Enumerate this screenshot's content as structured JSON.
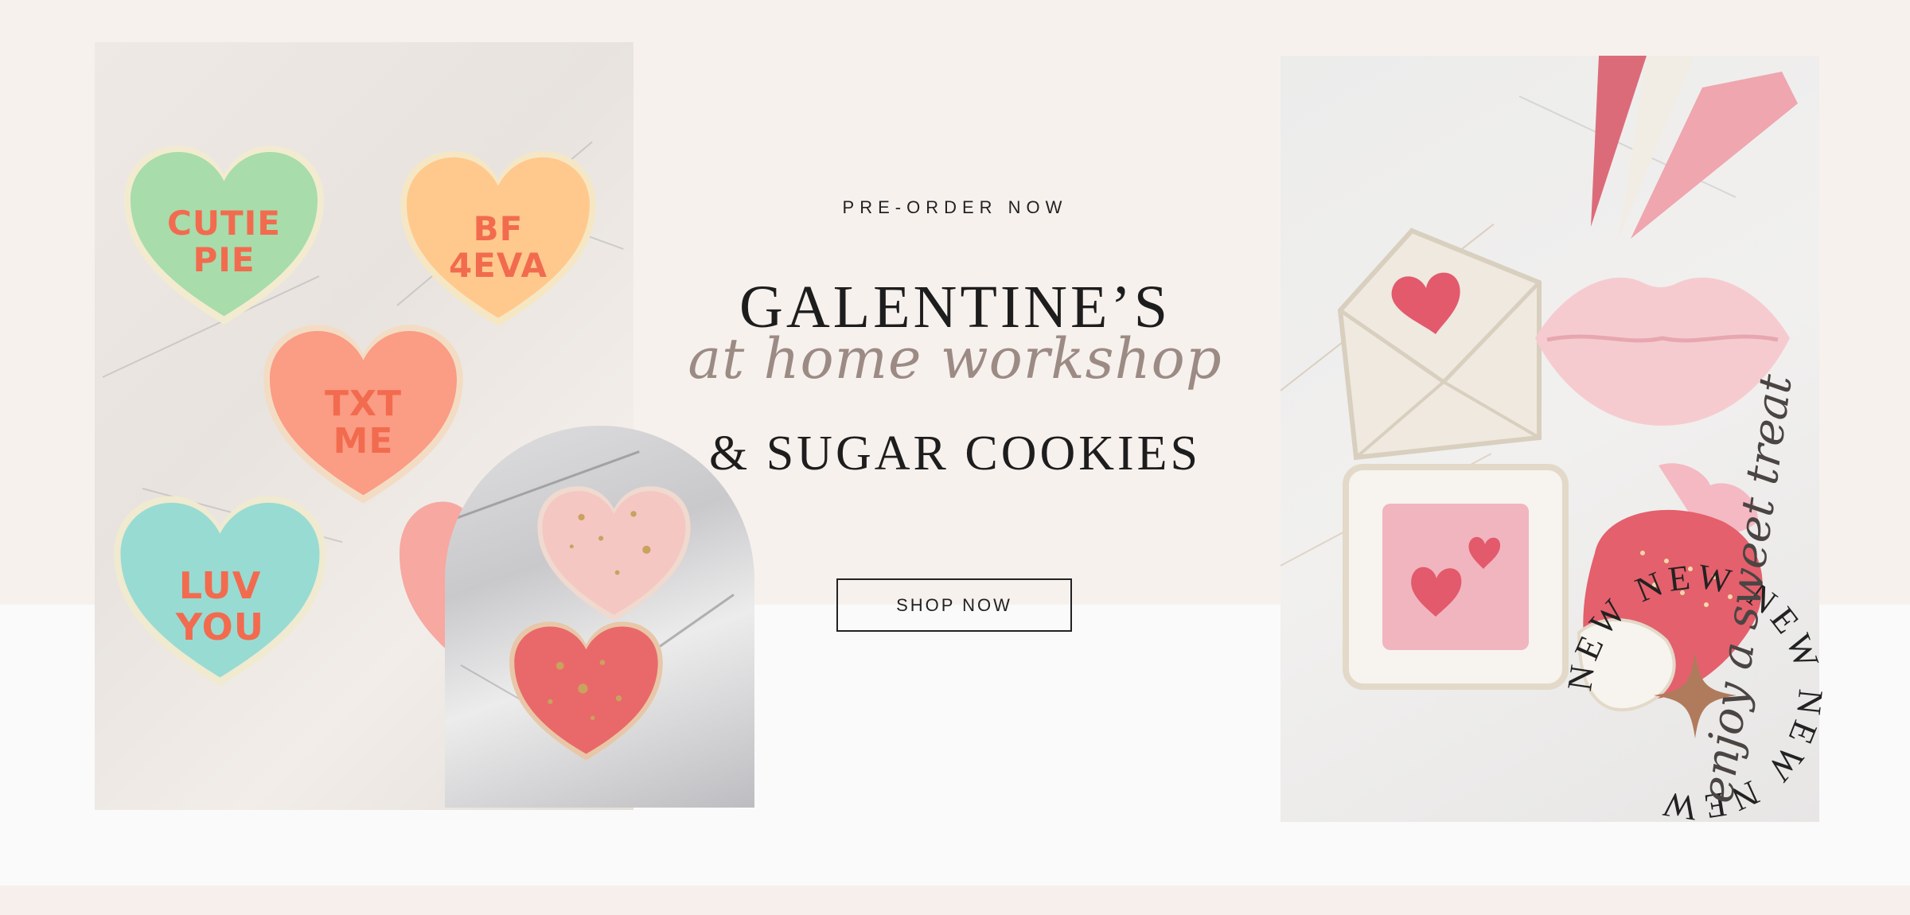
{
  "hero": {
    "eyebrow": "PRE-ORDER NOW",
    "title_line1": "GALENTINE’S",
    "title_script": "at home workshop",
    "title_line2": "& SUGAR COOKIES",
    "cta_label": "SHOP NOW"
  },
  "cookies_left": [
    {
      "label_line1": "CUTIE",
      "label_line2": "PIE",
      "color": "#a8dcab"
    },
    {
      "label_line1": "BF",
      "label_line2": "4EVA",
      "color": "#ffc98e"
    },
    {
      "label_line1": "TXT",
      "label_line2": "ME",
      "color": "#fb9c85"
    },
    {
      "label_line1": "LUV",
      "label_line2": "YOU",
      "color": "#98dbd3"
    }
  ],
  "badge": {
    "ring_text": "NEW NEW NEW NEW NEW",
    "script_text": "enjoy a sweet treat"
  },
  "colors": {
    "background": "#f7f1ee",
    "accent_coral": "#f26b4e",
    "script_taupe": "#9c8b84",
    "star_copper": "#b07b5c"
  }
}
